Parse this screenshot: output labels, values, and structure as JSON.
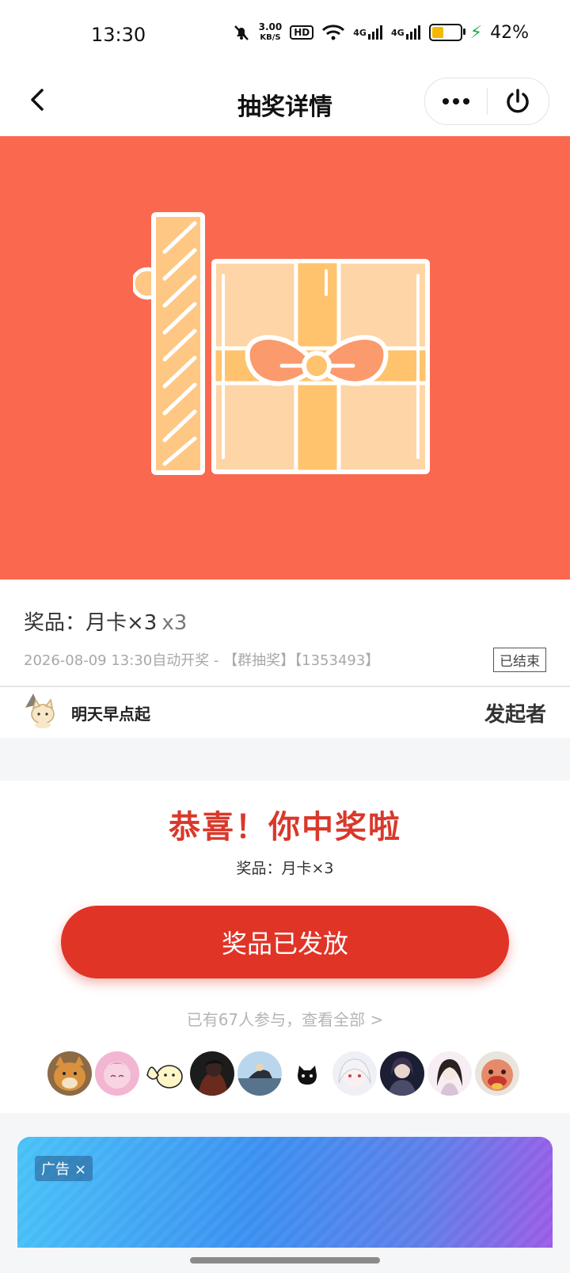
{
  "status_bar": {
    "time": "13:30",
    "net_speed": "3.00",
    "net_unit": "KB/S",
    "hd": "HD",
    "network1": "4G",
    "network2": "4G",
    "battery_percent": "42%",
    "battery_level": 0.42,
    "colors": {
      "battery_fill": "#f5b800",
      "charging": "#18b04a"
    }
  },
  "navbar": {
    "title": "抽奖详情",
    "back_icon": "chevron-left-icon",
    "more_icon": "more-dots-icon",
    "power_icon": "power-icon"
  },
  "hero": {
    "color": "#f9684f",
    "illustration": "gift-box-illustration"
  },
  "prize": {
    "label": "奖品：月卡×3",
    "multiplier": "x3",
    "meta": "2026-08-09 13:30自动开奖 - 【群抽奖】【1353493】",
    "status": "已结束"
  },
  "host": {
    "name": "明天早点起",
    "role": "发起者"
  },
  "win": {
    "title": "恭喜！你中奖啦",
    "prize": "奖品：月卡×3",
    "button": "奖品已发放",
    "participants": "已有67人参与，查看全部 >",
    "colors": {
      "accent": "#d9382b",
      "button": "#e03427"
    }
  },
  "ad": {
    "tag": "广告",
    "close": "×"
  }
}
